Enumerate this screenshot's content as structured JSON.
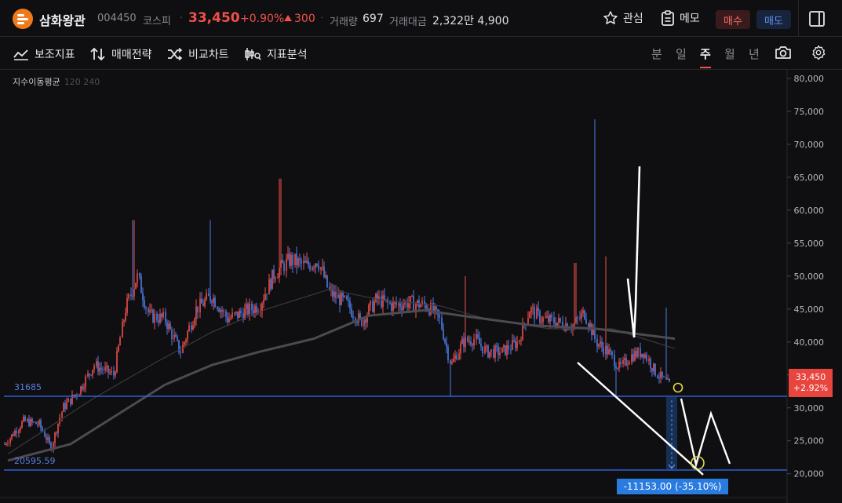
{
  "header": {
    "stock_name": "삼화왕관",
    "stock_code": "004450",
    "market": "코스피",
    "price": "33,450",
    "change_pct": "+0.90%",
    "change_abs": "300",
    "volume_label": "거래량",
    "volume_value": "697",
    "amount_label": "거래대금",
    "amount_value": "2,322만 4,900",
    "favorite_label": "관심",
    "memo_label": "메모",
    "buy_label": "매수",
    "sell_label": "매도"
  },
  "toolbar": {
    "tools": [
      "보조지표",
      "매매전략",
      "비교차트",
      "지표분석"
    ],
    "periods": [
      "분",
      "일",
      "주",
      "월",
      "년"
    ],
    "active_period": "주"
  },
  "chart": {
    "indicator": "지수이동평균",
    "indicator_params": "120 240",
    "y_ticks": [
      "80,000",
      "75,000",
      "70,000",
      "65,000",
      "60,000",
      "55,000",
      "50,000",
      "45,000",
      "40,000",
      "35,000",
      "30,000",
      "25,000",
      "20,000"
    ],
    "current_price": "33,450",
    "current_change": "+2.92%",
    "level_high_label": "31685",
    "level_low_label": "20595.59",
    "measure_label": "-11153.00  (-35.10%)"
  },
  "colors": {
    "up": "#f0504c",
    "down": "#4f7de8",
    "level_line": "#2f5fd6",
    "accent": "#f07a1a"
  },
  "chart_data": {
    "type": "candlestick",
    "y_unit": "KRW",
    "ylim": [
      18000,
      81000
    ],
    "horizontal_levels": [
      31685,
      20595.59
    ],
    "measure": {
      "from": 31685,
      "to": 20532,
      "diff": -11153.0,
      "pct": -35.1
    }
  }
}
